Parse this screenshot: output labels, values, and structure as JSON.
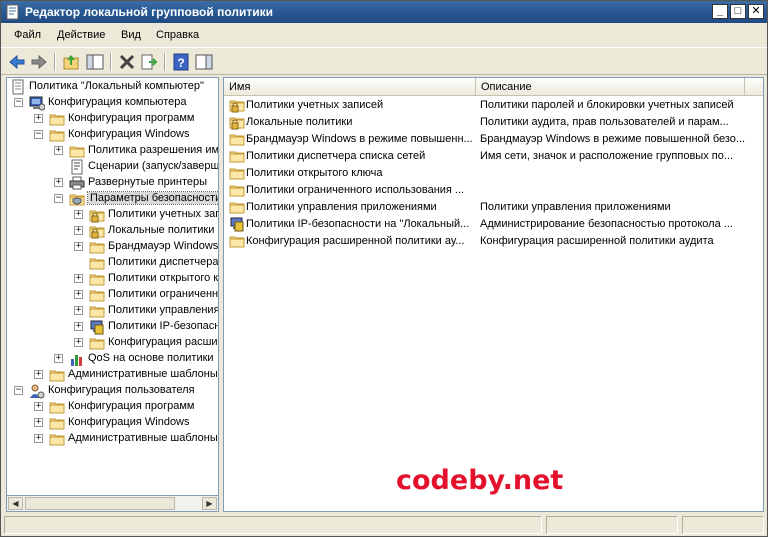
{
  "window": {
    "title": "Редактор локальной групповой политики"
  },
  "menu": [
    "Файл",
    "Действие",
    "Вид",
    "Справка"
  ],
  "tree": [
    {
      "label": "Политика \"Локальный компьютер\"",
      "icon": "policy-icon",
      "expander": "",
      "level": 0
    },
    {
      "label": "Конфигурация компьютера",
      "icon": "computer-icon",
      "expander": "−",
      "level": 1
    },
    {
      "label": "Конфигурация программ",
      "icon": "folder-icon",
      "expander": "+",
      "level": 2
    },
    {
      "label": "Конфигурация Windows",
      "icon": "folder-icon",
      "expander": "−",
      "level": 2
    },
    {
      "label": "Политика разрешения имен",
      "icon": "folder-icon",
      "expander": "+",
      "level": 3
    },
    {
      "label": "Сценарии (запуск/завершение)",
      "icon": "script-icon",
      "expander": "",
      "level": 3
    },
    {
      "label": "Развернутые принтеры",
      "icon": "printer-icon",
      "expander": "+",
      "level": 3
    },
    {
      "label": "Параметры безопасности",
      "icon": "security-folder-icon",
      "expander": "−",
      "level": 3,
      "selected": true
    },
    {
      "label": "Политики учетных записей",
      "icon": "lock-folder-icon",
      "expander": "+",
      "level": 4
    },
    {
      "label": "Локальные политики",
      "icon": "lock-folder-icon",
      "expander": "+",
      "level": 4
    },
    {
      "label": "Брандмауэр Windows в режиме",
      "icon": "folder-icon",
      "expander": "+",
      "level": 4
    },
    {
      "label": "Политики диспетчера",
      "icon": "folder-icon",
      "expander": "",
      "level": 4
    },
    {
      "label": "Политики открытого ключа",
      "icon": "folder-icon",
      "expander": "+",
      "level": 4
    },
    {
      "label": "Политики ограниченного",
      "icon": "folder-icon",
      "expander": "+",
      "level": 4
    },
    {
      "label": "Политики управления",
      "icon": "folder-icon",
      "expander": "+",
      "level": 4
    },
    {
      "label": "Политики IP-безопасности",
      "icon": "ipsec-icon",
      "expander": "+",
      "level": 4
    },
    {
      "label": "Конфигурация расширенной",
      "icon": "folder-icon",
      "expander": "+",
      "level": 4
    },
    {
      "label": "QoS на основе политики",
      "icon": "chart-icon",
      "expander": "+",
      "level": 3
    },
    {
      "label": "Административные шаблоны",
      "icon": "folder-icon",
      "expander": "+",
      "level": 2
    },
    {
      "label": "Конфигурация пользователя",
      "icon": "user-icon",
      "expander": "−",
      "level": 1
    },
    {
      "label": "Конфигурация программ",
      "icon": "folder-icon",
      "expander": "+",
      "level": 2
    },
    {
      "label": "Конфигурация Windows",
      "icon": "folder-icon",
      "expander": "+",
      "level": 2
    },
    {
      "label": "Административные шаблоны",
      "icon": "folder-icon",
      "expander": "+",
      "level": 2
    }
  ],
  "list": {
    "headers": {
      "name": "Имя",
      "description": "Описание"
    },
    "rows": [
      {
        "name": "Политики учетных записей",
        "description": "Политики паролей и блокировки учетных записей",
        "icon": "lock-folder-icon"
      },
      {
        "name": "Локальные политики",
        "description": "Политики аудита, прав пользователей и парам...",
        "icon": "lock-folder-icon"
      },
      {
        "name": "Брандмауэр Windows в режиме повышенн...",
        "description": "Брандмауэр Windows в режиме повышенной безо...",
        "icon": "folder-icon"
      },
      {
        "name": "Политики диспетчера списка сетей",
        "description": "Имя сети, значок и расположение групповых по...",
        "icon": "folder-icon"
      },
      {
        "name": "Политики открытого ключа",
        "description": "",
        "icon": "folder-icon"
      },
      {
        "name": "Политики ограниченного использования ...",
        "description": "",
        "icon": "folder-icon"
      },
      {
        "name": "Политики управления приложениями",
        "description": "Политики управления приложениями",
        "icon": "folder-icon"
      },
      {
        "name": "Политики IP-безопасности на \"Локальный...",
        "description": "Администрирование безопасностью протокола ...",
        "icon": "ipsec-icon"
      },
      {
        "name": "Конфигурация расширенной политики ау...",
        "description": "Конфигурация расширенной политики аудита",
        "icon": "folder-icon"
      }
    ]
  },
  "watermark": "codeby.net"
}
